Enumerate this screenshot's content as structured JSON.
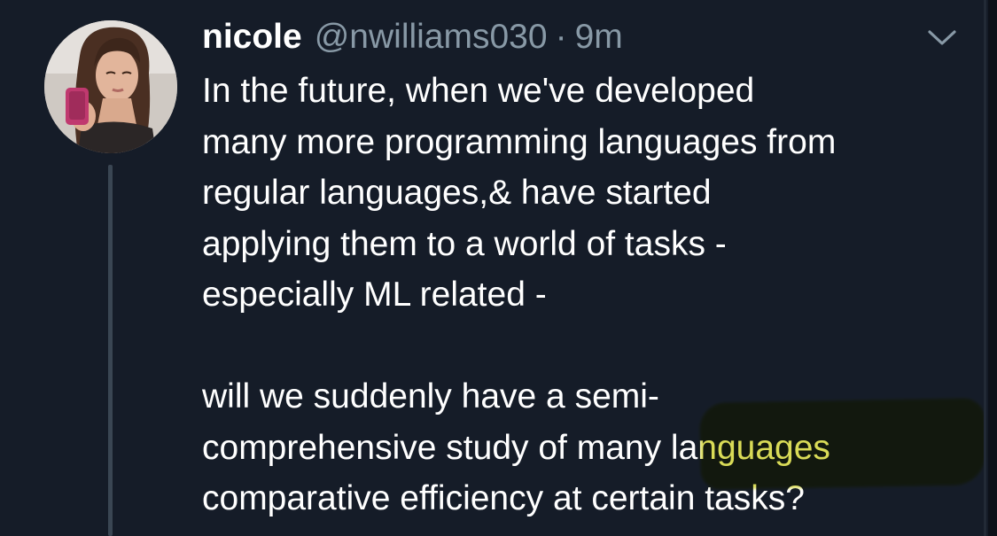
{
  "tweet": {
    "author": {
      "display_name": "nicole",
      "handle": "@nwilliams030",
      "separator": "·",
      "timestamp": "9m",
      "avatar": "profile-photo"
    },
    "menu_icon": "chevron-down-icon",
    "body": {
      "paragraph_1": [
        "In the future, when we've developed",
        "many more programming languages from",
        "regular languages,& have started",
        "applying them to a world of tasks -",
        "especially ML related -"
      ],
      "paragraph_2": [
        "will we suddenly have a semi-",
        "comprehensive study of many languages",
        "comparative efficiency at certain tasks?"
      ]
    },
    "highlight_color": "#d6d84a"
  },
  "colors": {
    "background": "#151c28",
    "text": "#ffffff",
    "muted": "#8899a6",
    "thread_line": "#3a4653"
  }
}
